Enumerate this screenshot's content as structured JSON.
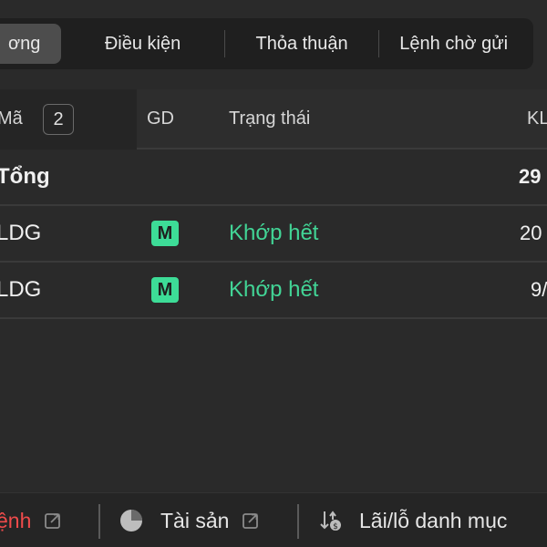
{
  "tabs": [
    {
      "label": "ơng",
      "active": true
    },
    {
      "label": "Điều kiện",
      "active": false
    },
    {
      "label": "Thỏa thuận",
      "active": false
    },
    {
      "label": "Lệnh chờ gửi",
      "active": false
    }
  ],
  "table": {
    "headers": {
      "code": "Mã",
      "count": "2",
      "exchange": "GD",
      "status": "Trạng thái",
      "quantity": "KL"
    },
    "total": {
      "label": "Tổng",
      "quantity": "29"
    },
    "rows": [
      {
        "code": "LDG",
        "exchange_badge": "M",
        "status": "Khớp hết",
        "quantity": "20"
      },
      {
        "code": "LDG",
        "exchange_badge": "M",
        "status": "Khớp hết",
        "quantity": "9/"
      }
    ]
  },
  "bottom": {
    "orders_label": "ệnh",
    "assets_label": "Tài sản",
    "pnl_label": "Lãi/lỗ danh mục"
  },
  "colors": {
    "accent_green": "#42d596",
    "badge_green": "#3ddc97",
    "alert_red": "#ef4b4b"
  },
  "icons": {
    "external": "external-link-icon",
    "assets": "pie-chart-icon",
    "pnl": "sort-dollar-icon"
  }
}
